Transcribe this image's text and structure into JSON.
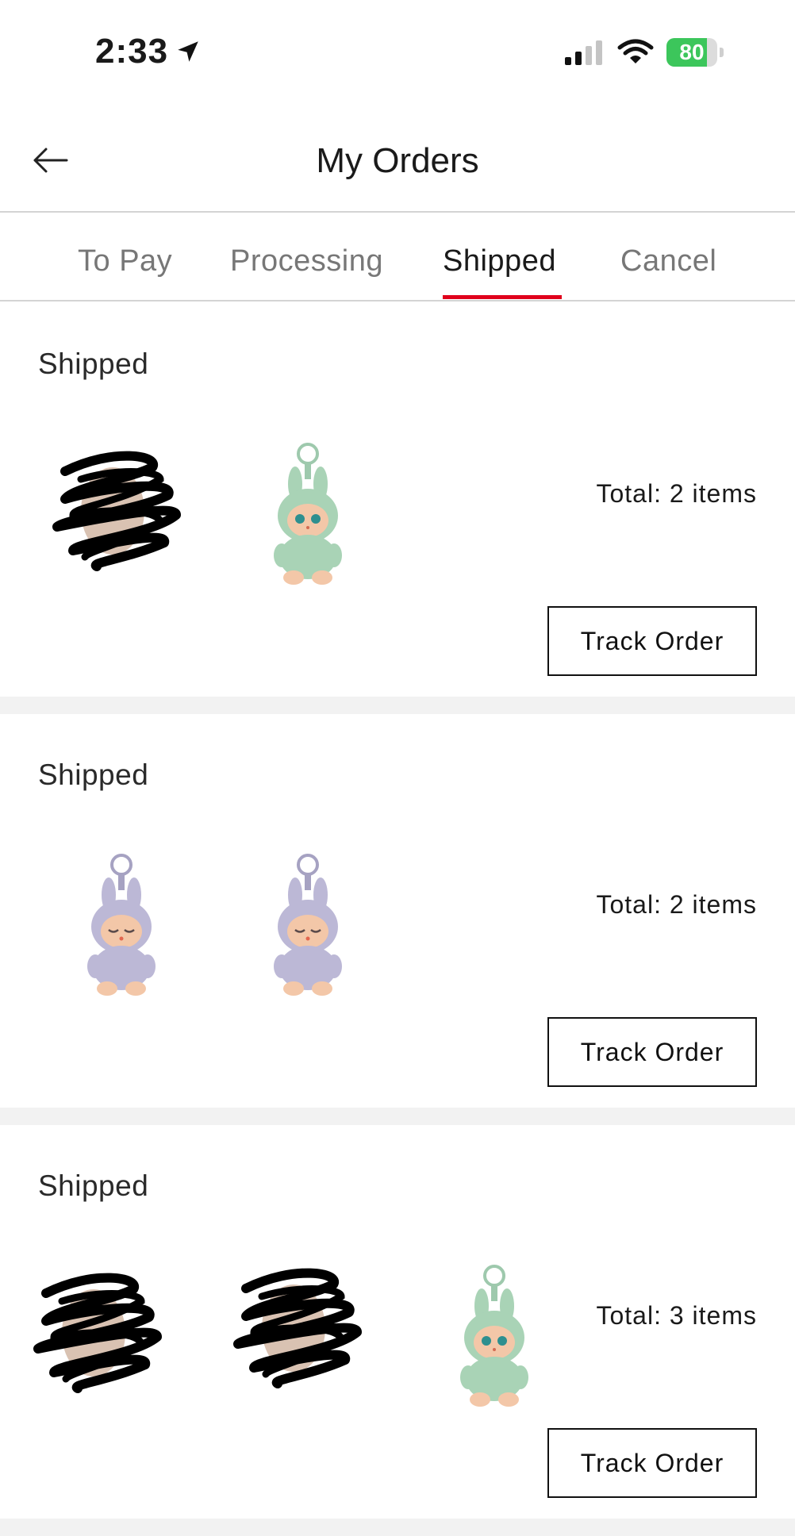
{
  "status_bar": {
    "time": "2:33",
    "battery": "80",
    "battery_level_percent": 80,
    "icons": [
      "location-arrow-icon",
      "cellular-signal-icon",
      "wifi-icon",
      "battery-charging-icon"
    ]
  },
  "header": {
    "title": "My Orders",
    "back_icon": "back-arrow-icon"
  },
  "tabs": [
    {
      "label": "To Pay",
      "active": false
    },
    {
      "label": "Processing",
      "active": false
    },
    {
      "label": "Shipped",
      "active": true
    },
    {
      "label": "Cancel",
      "active": false
    }
  ],
  "colors": {
    "accent": "#e0001b",
    "battery_green": "#3cc65b",
    "separator": "#f2f2f2",
    "doll_green": "#a9d3b6",
    "doll_lavender": "#bcb8d6"
  },
  "orders": [
    {
      "status": "Shipped",
      "total": "Total: 2 items",
      "action": "Track Order",
      "items": [
        "scribbled-out product image",
        "green plush keychain"
      ]
    },
    {
      "status": "Shipped",
      "total": "Total: 2 items",
      "action": "Track Order",
      "items": [
        "lavender plush keychain",
        "lavender plush keychain"
      ]
    },
    {
      "status": "Shipped",
      "total": "Total: 3 items",
      "action": "Track Order",
      "items": [
        "scribbled-out product image",
        "scribbled-out product image",
        "green plush keychain"
      ]
    }
  ]
}
